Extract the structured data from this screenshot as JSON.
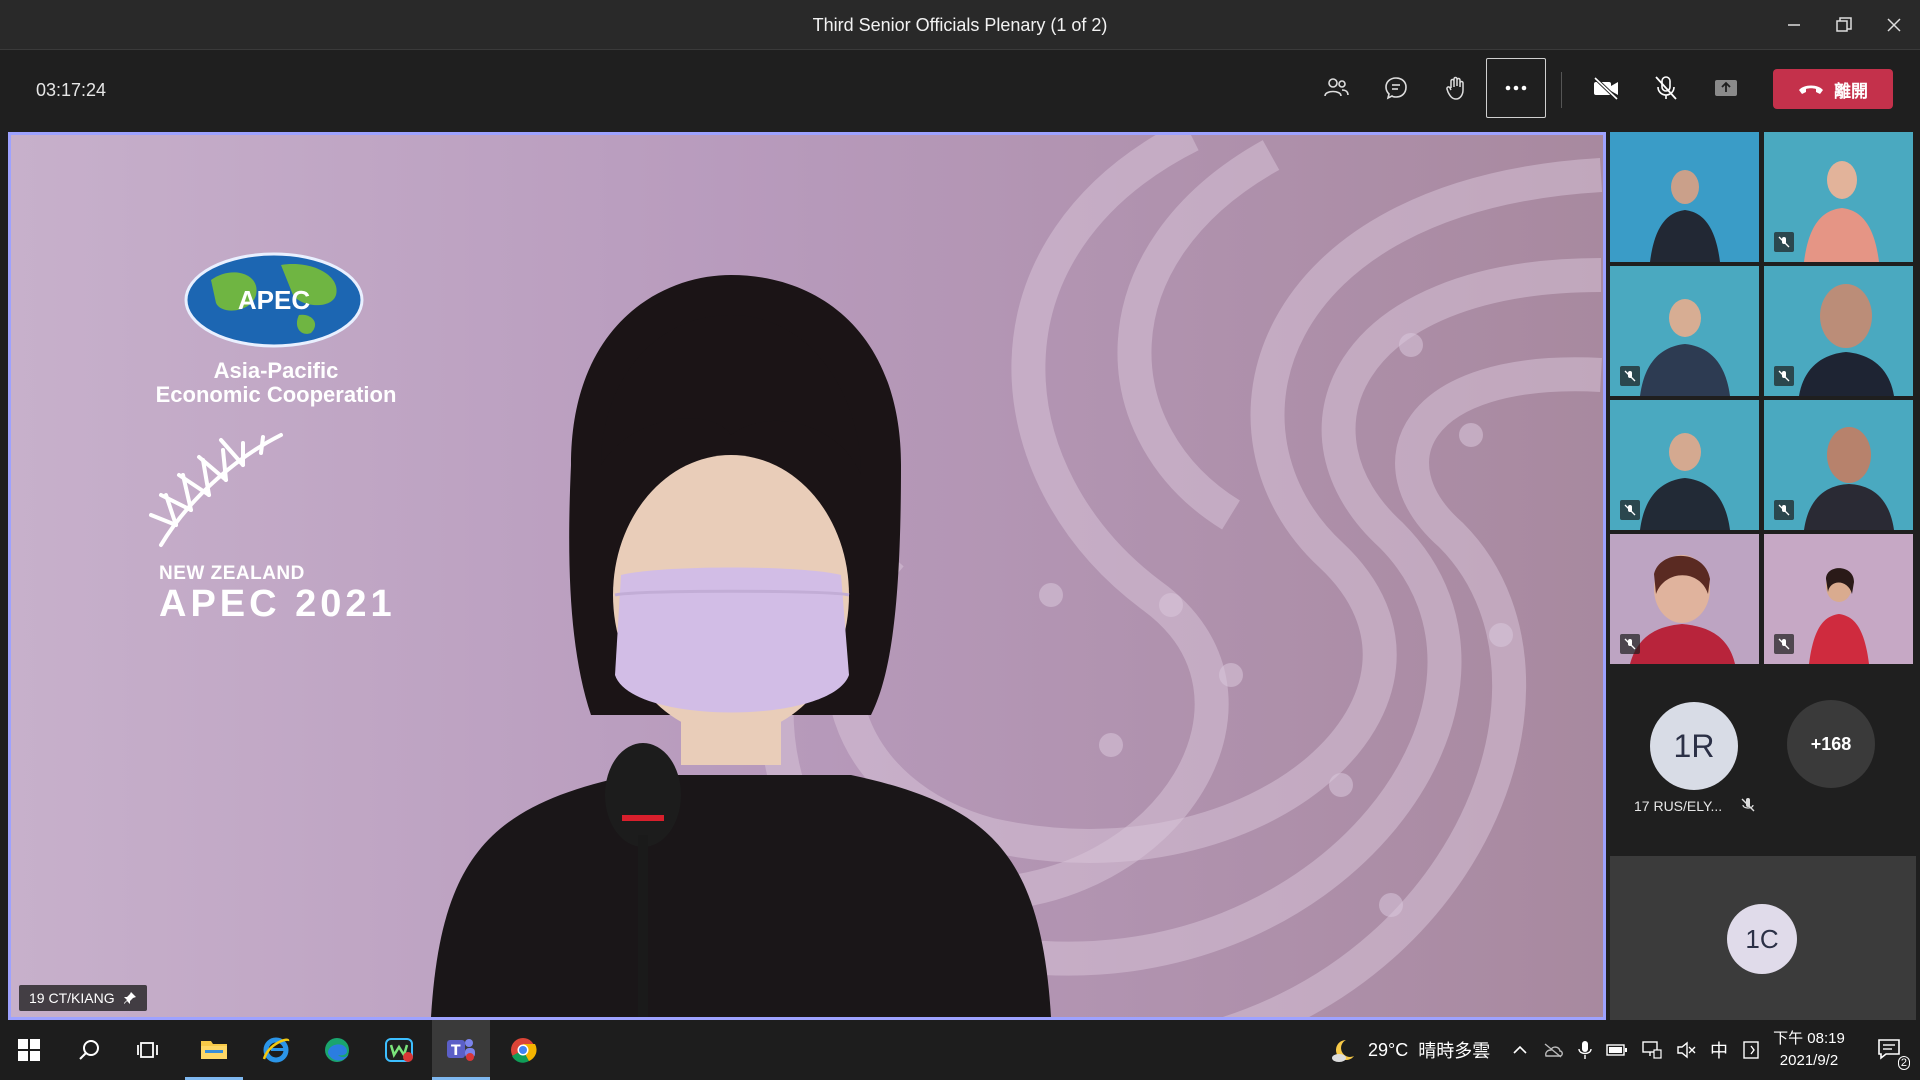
{
  "window": {
    "title": "Third Senior Officials Plenary (1 of 2)",
    "controls": [
      "minimize",
      "restore",
      "close"
    ]
  },
  "toolbar": {
    "timer": "03:17:24",
    "buttons": [
      {
        "name": "participants",
        "icon": "people-icon"
      },
      {
        "name": "chat",
        "icon": "chat-icon"
      },
      {
        "name": "raise-hand",
        "icon": "hand-icon"
      },
      {
        "name": "more-actions",
        "icon": "more-icon"
      },
      {
        "name": "camera",
        "icon": "camera-off-icon"
      },
      {
        "name": "mic",
        "icon": "mic-off-icon"
      },
      {
        "name": "share",
        "icon": "share-icon"
      }
    ],
    "leave_label": "離開"
  },
  "stage": {
    "speaker_name": "19 CT/KIANG",
    "logo_text": {
      "apec": "APEC",
      "line1": "Asia-Pacific",
      "line2": "Economic Cooperation",
      "nz": "NEW ZEALAND",
      "nz_year": "APEC 2021"
    }
  },
  "gallery": {
    "one_r": {
      "initials": "1R",
      "name": "17 RUS/ELY..."
    },
    "more_count": "+168",
    "one_c": {
      "initials": "1C"
    }
  },
  "taskbar": {
    "weather_temp": "29°C",
    "weather_desc": "晴時多雲",
    "ime": "中",
    "time": "下午 08:19",
    "date": "2021/9/2",
    "notifications": "2"
  },
  "colors": {
    "leave_red": "#c4314b",
    "stage_border": "#9ea2ff",
    "taskbar_accent": "#7fb8f0"
  }
}
